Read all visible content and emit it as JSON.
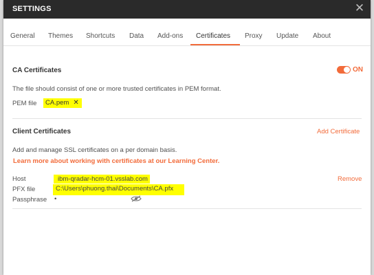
{
  "dialog": {
    "title": "SETTINGS",
    "close_icon": "close-icon"
  },
  "tabs": [
    {
      "label": "General"
    },
    {
      "label": "Themes"
    },
    {
      "label": "Shortcuts"
    },
    {
      "label": "Data"
    },
    {
      "label": "Add-ons"
    },
    {
      "label": "Certificates",
      "active": true
    },
    {
      "label": "Proxy"
    },
    {
      "label": "Update"
    },
    {
      "label": "About"
    }
  ],
  "ca_certificates": {
    "title": "CA Certificates",
    "toggle_label": "ON",
    "toggle_on": true,
    "description": "The file should consist of one or more trusted certificates in PEM format.",
    "pem_label": "PEM file",
    "pem_value": "CA.pem"
  },
  "client_certificates": {
    "title": "Client Certificates",
    "add_label": "Add Certificate",
    "description": "Add and manage SSL certificates on a per domain basis.",
    "learn_more": "Learn more about working with certificates at our Learning Center.",
    "host_label": "Host",
    "host_value": "ibm-qradar-hcm-01.vsslab.com",
    "remove_label": "Remove",
    "pfx_label": "PFX file",
    "pfx_value": "C:\\Users\\phuong.thai\\Documents\\CA.pfx",
    "passphrase_label": "Passphrase",
    "passphrase_value": "•"
  },
  "colors": {
    "accent": "#f26b3a",
    "titlebar": "#2a2a2a",
    "highlight": "#ffff00"
  }
}
